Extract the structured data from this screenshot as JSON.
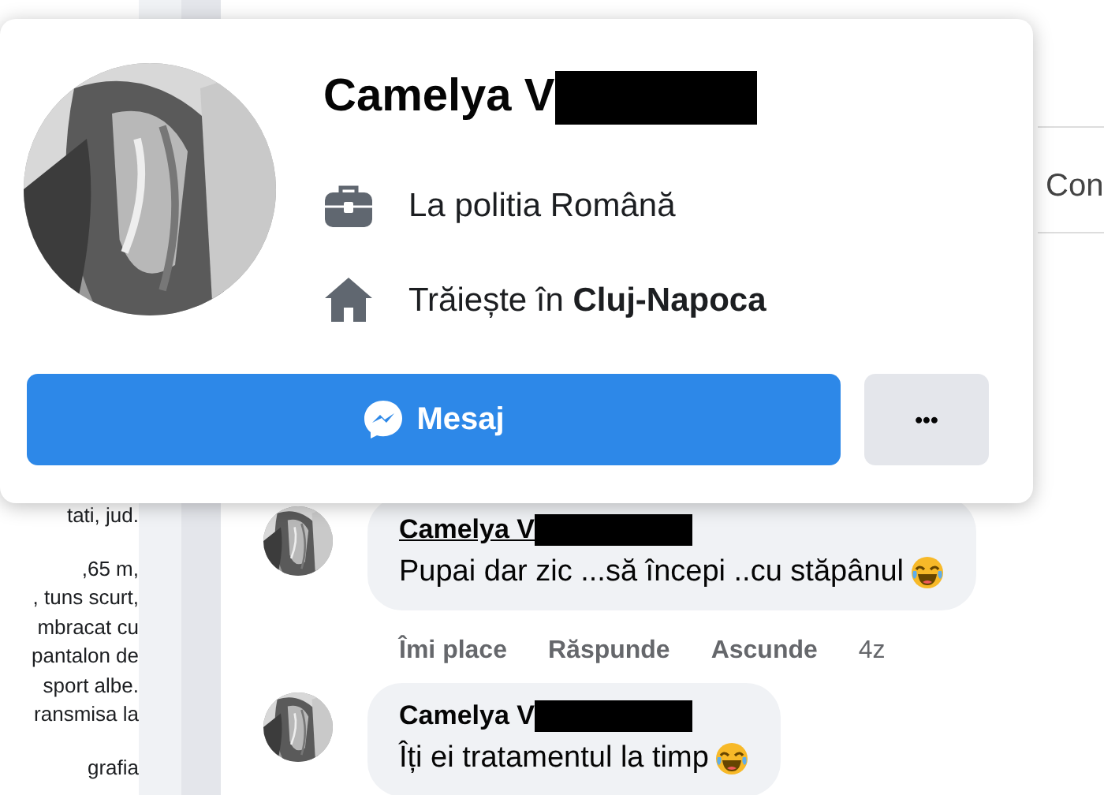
{
  "left_panel": {
    "paragraphs": [
      [
        "tati, jud."
      ],
      [
        ",65 m,",
        ", tuns scurt,",
        "mbracat cu",
        "pantalon de",
        "sport albe.",
        "ransmisa la"
      ],
      [
        "grafia"
      ]
    ]
  },
  "side_button": {
    "label": "Con"
  },
  "comments": [
    {
      "author": "Camelya V",
      "text": "Pupai dar zic ...să începi ..cu stăpânul",
      "emoji": true,
      "actions": [
        "Îmi place",
        "Răspunde",
        "Ascunde"
      ],
      "time": "4z"
    },
    {
      "author": "Camelya V",
      "text": "Îți ei tratamentul la timp",
      "emoji": true
    }
  ],
  "profile_card": {
    "name": "Camelya V",
    "details": [
      {
        "kind": "work",
        "text": "La politia Română"
      },
      {
        "kind": "home",
        "text": "Trăiește în **Cluj-Napoca**"
      }
    ],
    "buttons": [
      {
        "kind": "primary",
        "label": "Mesaj"
      },
      {
        "kind": "more",
        "label": "•••"
      }
    ]
  }
}
